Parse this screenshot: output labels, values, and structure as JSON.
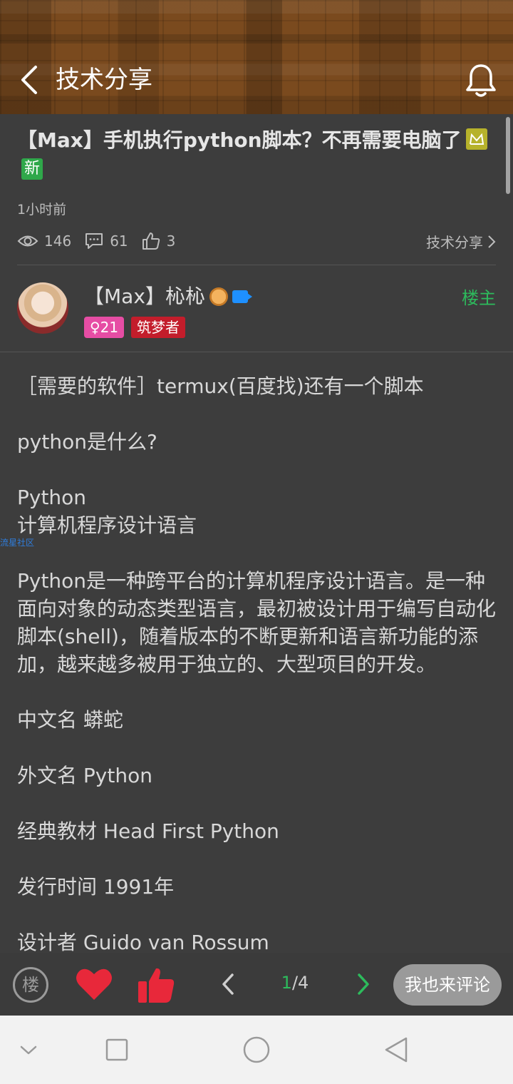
{
  "header": {
    "title": "技术分享"
  },
  "post": {
    "title": "【Max】手机执行python脚本？不再需要电脑了",
    "new_badge": "新",
    "time": "1小时前",
    "views": "146",
    "comments": "61",
    "likes": "3",
    "category": "技术分享"
  },
  "author": {
    "name": "【Max】杺杺",
    "gender_age": "♀21",
    "rank": "筑梦者",
    "op_label": "楼主"
  },
  "content": {
    "p1": "［需要的软件］termux(百度找)还有一个脚本",
    "p2": "python是什么?",
    "p3a": "Python",
    "p3b": "计算机程序设计语言",
    "p4": "Python是一种跨平台的计算机程序设计语言。是一种面向对象的动态类型语言，最初被设计用于编写自动化脚本(shell)，随着版本的不断更新和语言新功能的添加，越来越多被用于独立的、大型项目的开发。",
    "p5": "中文名 蟒蛇",
    "p6": "外文名 Python",
    "p7": "经典教材 Head First Python",
    "p8": "发行时间 1991年",
    "p9": "设计者 Guido van Rossum",
    "watermark": "流星社区"
  },
  "actions": {
    "floor": "楼",
    "page_current": "1",
    "page_total": "/4",
    "comment_button": "我也来评论"
  },
  "colors": {
    "accent_green": "#2dbb5c",
    "heart_red": "#e8283a",
    "rank_red": "#c31d2b",
    "gender_pink": "#e64da4"
  }
}
